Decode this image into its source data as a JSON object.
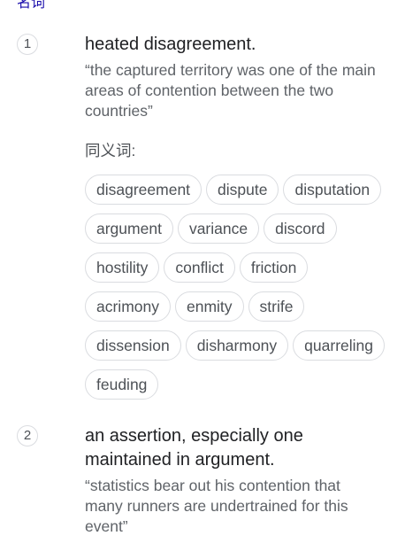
{
  "part_of_speech": "名词",
  "senses": [
    {
      "number": "1",
      "definition": "heated disagreement.",
      "example": "“the captured territory was one of the main areas of contention between the two countries”",
      "synonyms_label": "同义词:",
      "synonyms": [
        "disagreement",
        "dispute",
        "disputation",
        "argument",
        "variance",
        "discord",
        "hostility",
        "conflict",
        "friction",
        "acrimony",
        "enmity",
        "strife",
        "dissension",
        "disharmony",
        "quarreling",
        "feuding"
      ]
    },
    {
      "number": "2",
      "definition": "an assertion, especially one maintained in argument.",
      "example": "“statistics bear out his contention that many runners are undertrained for this event”"
    }
  ]
}
